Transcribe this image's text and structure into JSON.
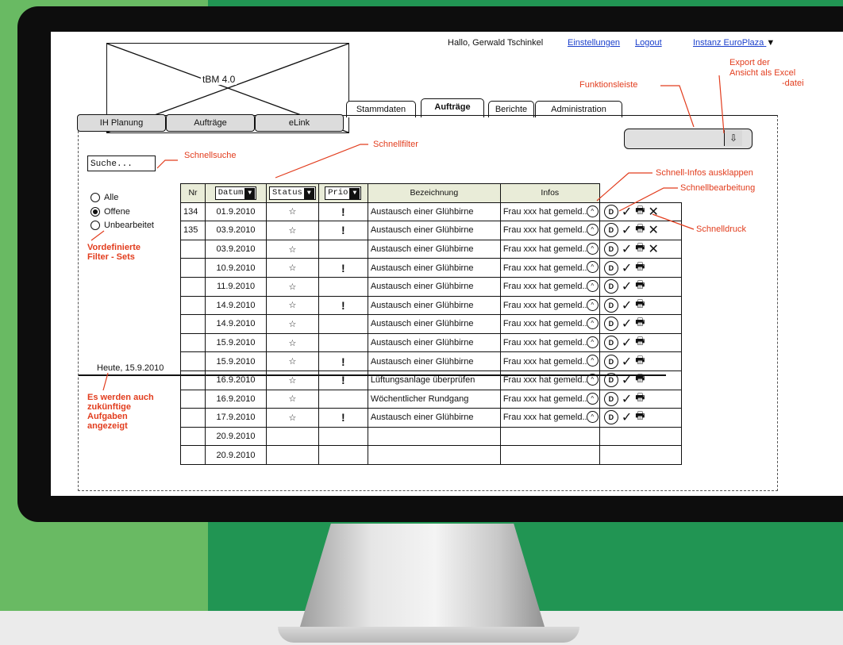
{
  "colors": {
    "accent_red": "#e23d1e",
    "link_blue": "#1a3fcc",
    "header_bg": "#e9ecd8"
  },
  "header": {
    "greeting": "Hallo, Gerwald Tschinkel",
    "settings_link": "Einstellungen",
    "logout_link": "Logout",
    "instance_select": "Instanz EuroPlaza"
  },
  "logo": {
    "text": "tBM 4.0"
  },
  "tabs": [
    {
      "label": "Stammdaten"
    },
    {
      "label": "Aufträge"
    },
    {
      "label": "Berichte"
    },
    {
      "label": "Administration"
    }
  ],
  "subtabs": [
    {
      "label": "IH Planung"
    },
    {
      "label": "Aufträge"
    },
    {
      "label": "eLink"
    }
  ],
  "search": {
    "value": "Suche..."
  },
  "filters": [
    {
      "label": "Alle",
      "selected": false
    },
    {
      "label": "Offene",
      "selected": true
    },
    {
      "label": "Unbearbeitet",
      "selected": false
    }
  ],
  "today_label": "Heute, 15.9.2010",
  "annotations": {
    "schnellsuche": "Schnellsuche",
    "schnellfilter": "Schnellfilter",
    "funktionsleiste": "Funktionsleiste",
    "export_1": "Export der",
    "export_2": "Ansicht als Excel",
    "export_3": "-datei",
    "schnell_infos": "Schnell-Infos ausklappen",
    "schnellbearbeitung": "Schnellbearbeitung",
    "schnelldruck": "Schnelldruck",
    "filtersets_1": "Vordefinierte",
    "filtersets_2": "Filter - Sets",
    "future_1": "Es werden auch",
    "future_2": "zukünftige",
    "future_3": "Aufgaben",
    "future_4": "angezeigt"
  },
  "table": {
    "headers": {
      "nr": "Nr",
      "datum": "Datum",
      "status": "Status",
      "prio": "Prio",
      "bezeichnung": "Bezeichnung",
      "infos": "Infos"
    },
    "rows": [
      {
        "nr": "134",
        "datum": "01.9.2010",
        "star": "☆",
        "prio": "!",
        "bez": "Austausch einer Glühbirne",
        "info": "Frau xxx hat gemeld...",
        "x": true,
        "empty": false
      },
      {
        "nr": "135",
        "datum": "03.9.2010",
        "star": "☆",
        "prio": "!",
        "bez": "Austausch einer Glühbirne",
        "info": "Frau xxx hat gemeld...",
        "x": true,
        "empty": false
      },
      {
        "nr": "",
        "datum": "03.9.2010",
        "star": "☆",
        "prio": "",
        "bez": "Austausch einer Glühbirne",
        "info": "Frau xxx hat gemeld...",
        "x": true,
        "empty": false
      },
      {
        "nr": "",
        "datum": "10.9.2010",
        "star": "☆",
        "prio": "!",
        "bez": "Austausch einer Glühbirne",
        "info": "Frau xxx hat gemeld...",
        "x": false,
        "empty": false
      },
      {
        "nr": "",
        "datum": "11.9.2010",
        "star": "☆",
        "prio": "",
        "bez": "Austausch einer Glühbirne",
        "info": "Frau xxx hat gemeld...",
        "x": false,
        "empty": false
      },
      {
        "nr": "",
        "datum": "14.9.2010",
        "star": "☆",
        "prio": "!",
        "bez": "Austausch einer Glühbirne",
        "info": "Frau xxx hat gemeld...",
        "x": false,
        "empty": false
      },
      {
        "nr": "",
        "datum": "14.9.2010",
        "star": "☆",
        "prio": "",
        "bez": "Austausch einer Glühbirne",
        "info": "Frau xxx hat gemeld...",
        "x": false,
        "empty": false
      },
      {
        "nr": "",
        "datum": "15.9.2010",
        "star": "☆",
        "prio": "",
        "bez": "Austausch einer Glühbirne",
        "info": "Frau xxx hat gemeld...",
        "x": false,
        "empty": false
      },
      {
        "nr": "",
        "datum": "15.9.2010",
        "star": "☆",
        "prio": "!",
        "bez": "Austausch einer Glühbirne",
        "info": "Frau xxx hat gemeld...",
        "x": false,
        "empty": false
      },
      {
        "nr": "",
        "datum": "16.9.2010",
        "star": "☆",
        "prio": "!",
        "bez": "Lüftungsanlage überprüfen",
        "info": "Frau xxx hat gemeld...",
        "x": false,
        "empty": false
      },
      {
        "nr": "",
        "datum": "16.9.2010",
        "star": "☆",
        "prio": "",
        "bez": "Wöchentlicher Rundgang",
        "info": "Frau xxx hat gemeld...",
        "x": false,
        "empty": false
      },
      {
        "nr": "",
        "datum": "17.9.2010",
        "star": "☆",
        "prio": "!",
        "bez": "Austausch einer Glühbirne",
        "info": "Frau xxx hat gemeld...",
        "x": false,
        "empty": false
      },
      {
        "nr": "",
        "datum": "20.9.2010",
        "star": "",
        "prio": "",
        "bez": "",
        "info": "",
        "x": false,
        "empty": true
      },
      {
        "nr": "",
        "datum": "20.9.2010",
        "star": "",
        "prio": "",
        "bez": "",
        "info": "",
        "x": false,
        "empty": true
      }
    ]
  },
  "icons": {
    "info_expand": "^",
    "quick_view": "D",
    "check": "✓",
    "print": "🖶",
    "delete": "✕",
    "export": "⇩"
  }
}
